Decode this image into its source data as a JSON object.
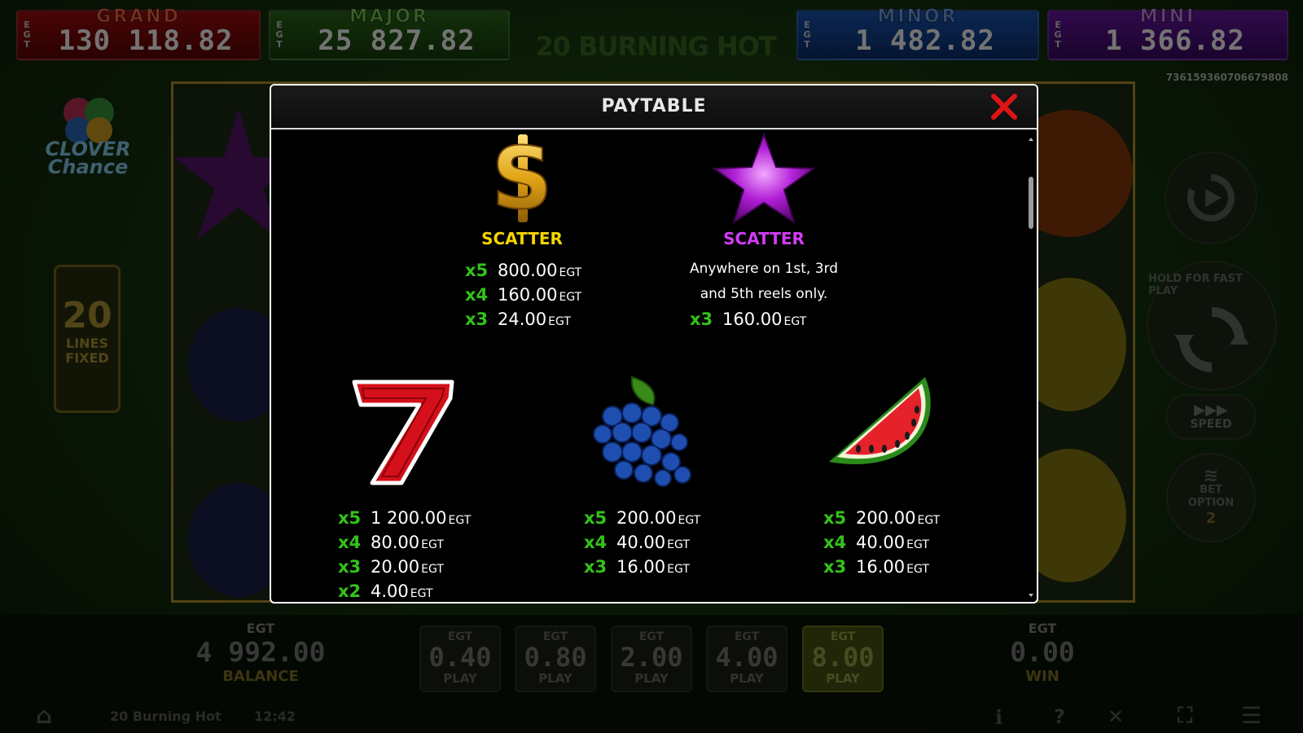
{
  "jackpots": {
    "grand": {
      "name": "GRAND",
      "value": "130 118.82",
      "brand": "EGT"
    },
    "major": {
      "name": "MAJOR",
      "value": "25 827.82",
      "brand": "EGT"
    },
    "minor": {
      "name": "MINOR",
      "value": "1 482.82",
      "brand": "EGT"
    },
    "mini": {
      "name": "MINI",
      "value": "1 366.82",
      "brand": "EGT"
    }
  },
  "game_title": "20 BURNING HOT",
  "ticket_id": "736159360706679808",
  "logo": {
    "line1": "CLOVER",
    "line2": "Chance"
  },
  "lines": {
    "count": "20",
    "label1": "LINES",
    "label2": "FIXED"
  },
  "side_buttons": {
    "autoplay_icon": "autoplay-icon",
    "hold_text": "HOLD FOR FAST PLAY",
    "speed_label": "SPEED",
    "bet_option_label1": "BET",
    "bet_option_label2": "OPTION",
    "bet_option_value": "2"
  },
  "balance": {
    "currency": "EGT",
    "value": "4 992.00",
    "label": "BALANCE"
  },
  "win": {
    "currency": "EGT",
    "value": "0.00",
    "label": "WIN"
  },
  "bets": [
    {
      "currency": "EGT",
      "value": "0.40",
      "label": "PLAY"
    },
    {
      "currency": "EGT",
      "value": "0.80",
      "label": "PLAY"
    },
    {
      "currency": "EGT",
      "value": "2.00",
      "label": "PLAY"
    },
    {
      "currency": "EGT",
      "value": "4.00",
      "label": "PLAY"
    },
    {
      "currency": "EGT",
      "value": "8.00",
      "label": "PLAY"
    }
  ],
  "status": {
    "game_name": "20 Burning Hot",
    "time": "12:42"
  },
  "paytable": {
    "title": "PAYTABLE",
    "dollar": {
      "label": "SCATTER",
      "label_color": "#f5d400",
      "pays": [
        {
          "mult": "x5",
          "amount": "800.00",
          "cur": "EGT"
        },
        {
          "mult": "x4",
          "amount": "160.00",
          "cur": "EGT"
        },
        {
          "mult": "x3",
          "amount": "24.00",
          "cur": "EGT"
        }
      ]
    },
    "star": {
      "label": "SCATTER",
      "label_color": "#d23cf5",
      "desc1": "Anywhere on 1st, 3rd",
      "desc2": "and 5th reels only.",
      "pays": [
        {
          "mult": "x3",
          "amount": "160.00",
          "cur": "EGT"
        }
      ]
    },
    "seven": {
      "pays": [
        {
          "mult": "x5",
          "amount": "1 200.00",
          "cur": "EGT"
        },
        {
          "mult": "x4",
          "amount": "80.00",
          "cur": "EGT"
        },
        {
          "mult": "x3",
          "amount": "20.00",
          "cur": "EGT"
        },
        {
          "mult": "x2",
          "amount": "4.00",
          "cur": "EGT"
        }
      ]
    },
    "grapes": {
      "pays": [
        {
          "mult": "x5",
          "amount": "200.00",
          "cur": "EGT"
        },
        {
          "mult": "x4",
          "amount": "40.00",
          "cur": "EGT"
        },
        {
          "mult": "x3",
          "amount": "16.00",
          "cur": "EGT"
        }
      ]
    },
    "watermelon": {
      "pays": [
        {
          "mult": "x5",
          "amount": "200.00",
          "cur": "EGT"
        },
        {
          "mult": "x4",
          "amount": "40.00",
          "cur": "EGT"
        },
        {
          "mult": "x3",
          "amount": "16.00",
          "cur": "EGT"
        }
      ]
    }
  },
  "colors": {
    "multiplier_green": "#34c21a",
    "frame_gold": "#b8962c",
    "close_red": "#e01414"
  }
}
